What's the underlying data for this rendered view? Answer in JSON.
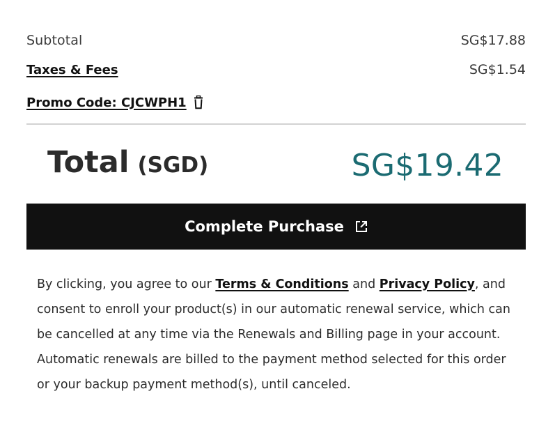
{
  "summary": {
    "subtotal_label": "Subtotal",
    "subtotal_value": "SG$17.88",
    "taxes_label": "Taxes & Fees",
    "taxes_value": "SG$1.54",
    "promo_label": "Promo Code: CJCWPH1",
    "promo_remove_icon": "trash-icon"
  },
  "total": {
    "label": "Total",
    "currency": "(SGD)",
    "value": "SG$19.42",
    "value_color": "#1b6b72"
  },
  "purchase_button": {
    "label": "Complete Purchase",
    "icon": "external-link-icon",
    "background": "#111111"
  },
  "legal": {
    "text_before_terms": "By clicking, you agree to our ",
    "terms_link": "Terms & Conditions",
    "text_between": " and ",
    "privacy_link": "Privacy Policy",
    "text_after": ", and consent to enroll your product(s) in our automatic renewal service, which can be cancelled at any time via the Renewals and Billing page in your account. Automatic renewals are billed to the payment method selected for this order or your backup payment method(s), until canceled."
  }
}
